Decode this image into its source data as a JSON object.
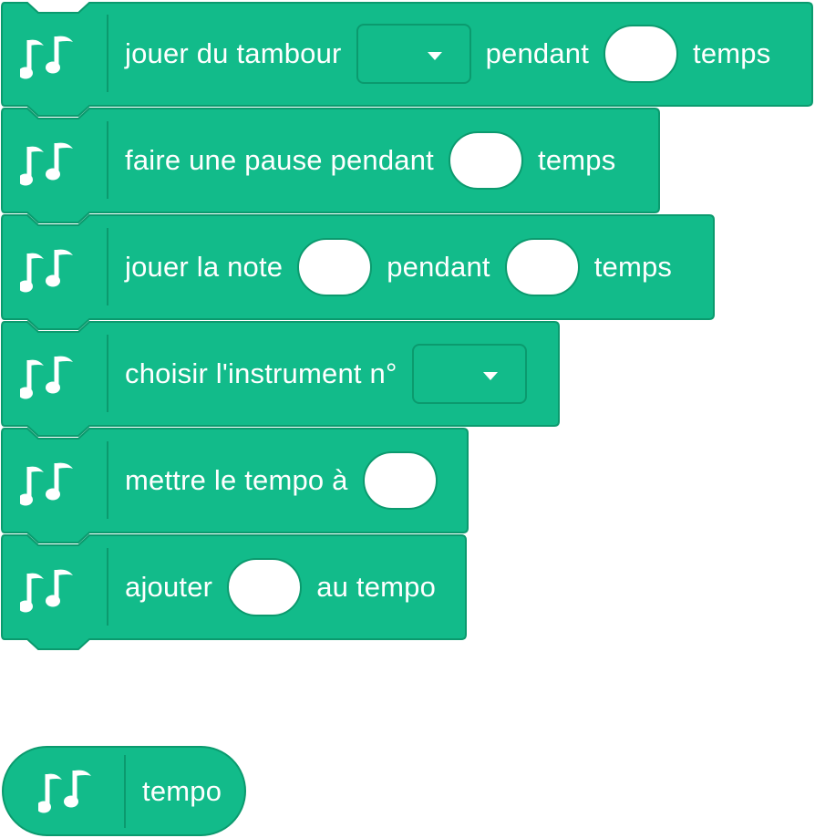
{
  "colors": {
    "block_fill": "#12bb8a",
    "block_stroke": "#0b9a6e",
    "text": "#ffffff"
  },
  "icon": "music-notes-icon",
  "blocks": {
    "play_drum": {
      "t1": "jouer du tambour",
      "t2": "pendant",
      "t3": "temps",
      "drum_value": ""
    },
    "rest": {
      "t1": "faire une pause pendant",
      "t2": "temps"
    },
    "play_note": {
      "t1": "jouer la note",
      "t2": "pendant",
      "t3": "temps"
    },
    "set_instrument": {
      "t1": "choisir l'instrument n°",
      "instrument_value": ""
    },
    "set_tempo": {
      "t1": "mettre le tempo à"
    },
    "change_tempo": {
      "t1": "ajouter",
      "t2": "au tempo"
    }
  },
  "reporter": {
    "label": "tempo"
  }
}
